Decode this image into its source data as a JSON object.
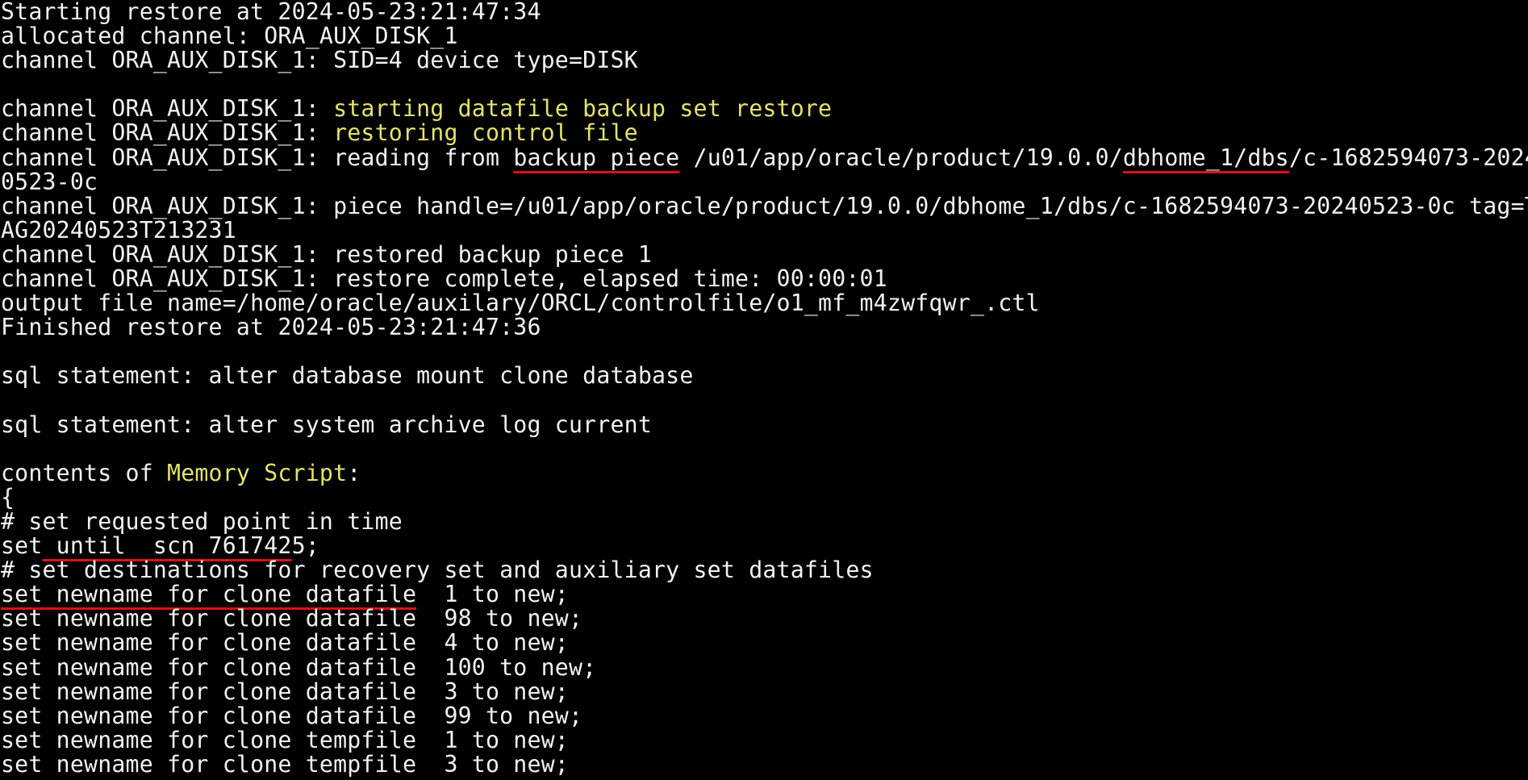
{
  "colors": {
    "background": "#000000",
    "foreground": "#f2f2f2",
    "highlight": "#e3e36a",
    "annotation_underline": "#e01010"
  },
  "terminal": {
    "lines": [
      [
        {
          "t": "Starting restore at 2024-05-23:21:47:34"
        }
      ],
      [
        {
          "t": "allocated channel: ORA_AUX_DISK_1"
        }
      ],
      [
        {
          "t": "channel ORA_AUX_DISK_1: SID=4 device type=DISK"
        }
      ],
      [],
      [
        {
          "t": "channel ORA_AUX_DISK_1: "
        },
        {
          "t": "starting datafile backup set restore",
          "hl": true
        }
      ],
      [
        {
          "t": "channel ORA_AUX_DISK_1: "
        },
        {
          "t": "restoring control file",
          "hl": true
        }
      ],
      [
        {
          "t": "channel ORA_AUX_DISK_1: reading from "
        },
        {
          "t": "backup piece",
          "ul": true
        },
        {
          "t": " /u01/app/oracle/product/19.0.0/"
        },
        {
          "t": "dbhome_1/dbs",
          "ul": true
        },
        {
          "t": "/c-1682594073-2024"
        }
      ],
      [
        {
          "t": "0523-0c"
        }
      ],
      [
        {
          "t": "channel ORA_AUX_DISK_1: piece handle=/u01/app/oracle/product/19.0.0/dbhome_1/dbs/c-1682594073-20240523-0c tag=T"
        }
      ],
      [
        {
          "t": "AG20240523T213231"
        }
      ],
      [
        {
          "t": "channel ORA_AUX_DISK_1: restored backup piece 1"
        }
      ],
      [
        {
          "t": "channel ORA_AUX_DISK_1: restore complete, elapsed time: 00:00:01"
        }
      ],
      [
        {
          "t": "output file name=/home/oracle/auxilary/ORCL/controlfile/o1_mf_m4zwfqwr_.ctl"
        }
      ],
      [
        {
          "t": "Finished restore at 2024-05-23:21:47:36"
        }
      ],
      [],
      [
        {
          "t": "sql statement: alter database mount clone database"
        }
      ],
      [],
      [
        {
          "t": "sql statement: alter system archive log current"
        }
      ],
      [],
      [
        {
          "t": "contents of "
        },
        {
          "t": "Memory Script",
          "hl": true
        },
        {
          "t": ":"
        }
      ],
      [
        {
          "t": "{"
        }
      ],
      [
        {
          "t": "# set requested point in time"
        }
      ],
      [
        {
          "t": "set"
        },
        {
          "t": " until  scn 761742",
          "ul": true
        },
        {
          "t": "5;"
        }
      ],
      [
        {
          "t": "# set destinations for recovery set and auxiliary set datafiles"
        }
      ],
      [
        {
          "t": "set newname for clone datafile",
          "ul": true
        },
        {
          "t": "  1 to new;"
        }
      ],
      [
        {
          "t": "set newname for clone datafile  98 to new;"
        }
      ],
      [
        {
          "t": "set newname for clone datafile  4 to new;"
        }
      ],
      [
        {
          "t": "set newname for clone datafile  100 to new;"
        }
      ],
      [
        {
          "t": "set newname for clone datafile  3 to new;"
        }
      ],
      [
        {
          "t": "set newname for clone datafile  99 to new;"
        }
      ],
      [
        {
          "t": "set newname for clone tempfile  1 to new;"
        }
      ],
      [
        {
          "t": "set newname for clone tempfile  3 to new;"
        }
      ]
    ]
  }
}
